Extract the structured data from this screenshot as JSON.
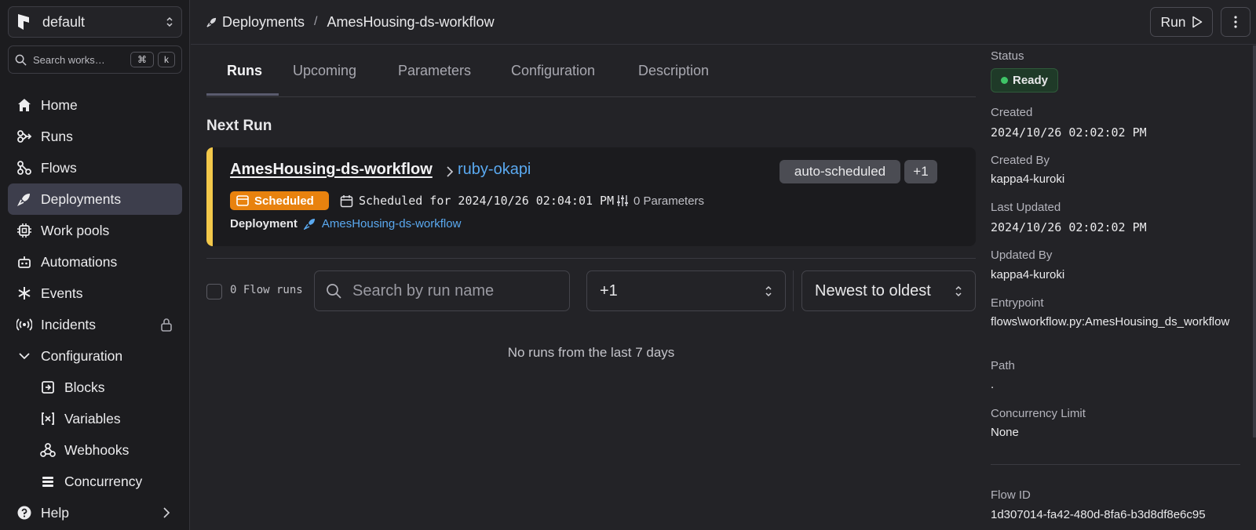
{
  "sidebar": {
    "workspace": "default",
    "search_placeholder": "Search works…",
    "search_kbd_1": "⌘",
    "search_kbd_2": "k",
    "items": [
      {
        "label": "Home"
      },
      {
        "label": "Runs"
      },
      {
        "label": "Flows"
      },
      {
        "label": "Deployments"
      },
      {
        "label": "Work pools"
      },
      {
        "label": "Automations"
      },
      {
        "label": "Events"
      },
      {
        "label": "Incidents"
      },
      {
        "label": "Configuration"
      },
      {
        "label": "Blocks"
      },
      {
        "label": "Variables"
      },
      {
        "label": "Webhooks"
      },
      {
        "label": "Concurrency"
      },
      {
        "label": "Help"
      }
    ]
  },
  "header": {
    "crumb_parent": "Deployments",
    "crumb_sep": "/",
    "crumb_current": "AmesHousing-ds-workflow",
    "run_label": "Run"
  },
  "tabs": [
    {
      "label": "Runs"
    },
    {
      "label": "Upcoming"
    },
    {
      "label": "Parameters"
    },
    {
      "label": "Configuration"
    },
    {
      "label": "Description"
    }
  ],
  "next_run": {
    "title": "Next Run",
    "flow_name": "AmesHousing-ds-workflow",
    "run_name": "ruby-okapi",
    "tags": [
      "auto-scheduled",
      "+1"
    ],
    "state": "Scheduled",
    "scheduled_text": "Scheduled for 2024/10/26 02:04:01 PM",
    "parameters_text": "0 Parameters",
    "deployment_label": "Deployment",
    "deployment_name": "AmesHousing-ds-workflow"
  },
  "filters": {
    "flow_runs_count": "0 Flow runs",
    "search_placeholder": "Search by run name",
    "state_filter": "+1",
    "sort": "Newest to oldest"
  },
  "empty_message": "No runs from the last 7 days",
  "details": {
    "status_label": "Status",
    "status_value": "Ready",
    "created_label": "Created",
    "created_value": "2024/10/26 02:02:02 PM",
    "created_by_label": "Created By",
    "created_by_value": "kappa4-kuroki",
    "last_updated_label": "Last Updated",
    "last_updated_value": "2024/10/26 02:02:02 PM",
    "updated_by_label": "Updated By",
    "updated_by_value": "kappa4-kuroki",
    "entrypoint_label": "Entrypoint",
    "entrypoint_value": "flows\\workflow.py:AmesHousing_ds_workflow",
    "path_label": "Path",
    "path_value": ".",
    "concurrency_label": "Concurrency Limit",
    "concurrency_value": "None",
    "flow_id_label": "Flow ID",
    "flow_id_value": "1d307014-fa42-480d-8fa6-b3d8df8e6c95"
  },
  "colors": {
    "accent_link": "#5aa9f0",
    "scheduled": "#e8820e",
    "next_run_bar": "#f3c84a",
    "ready_dot": "#3fc467"
  }
}
